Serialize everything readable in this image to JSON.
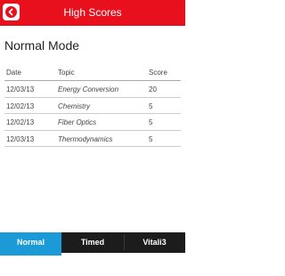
{
  "header": {
    "title": "High Scores",
    "back_icon": "back-arrow-icon",
    "color": "#e8101c"
  },
  "section": {
    "title": "Normal Mode"
  },
  "table": {
    "columns": [
      "Date",
      "Topic",
      "Score"
    ],
    "rows": [
      {
        "date": "12/03/13",
        "topic": "Energy Conversion",
        "score": "20"
      },
      {
        "date": "12/02/13",
        "topic": "Chemistry",
        "score": "5"
      },
      {
        "date": "12/02/13",
        "topic": "Fiber Optics",
        "score": "5"
      },
      {
        "date": "12/03/13",
        "topic": "Thermodynamics",
        "score": "5"
      }
    ]
  },
  "tabs": [
    {
      "label": "Normal",
      "active": true
    },
    {
      "label": "Timed",
      "active": false
    },
    {
      "label": "Vitali3",
      "active": false
    }
  ],
  "colors": {
    "accent": "#1a9ad6",
    "tabbar": "#1c1c1c"
  }
}
